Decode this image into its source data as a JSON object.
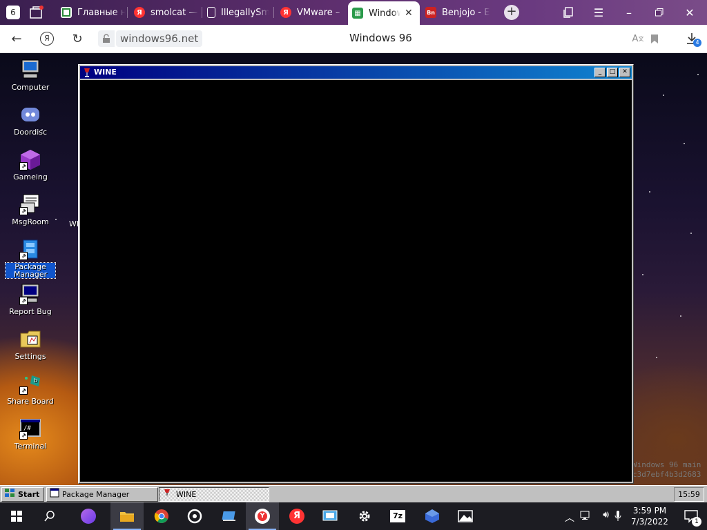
{
  "browser": {
    "tab_count": "6",
    "tabs": [
      {
        "label": "Главные н"
      },
      {
        "label": "smolcat —"
      },
      {
        "label": "IllegallySm"
      },
      {
        "label": "VMware –"
      },
      {
        "label": "Window"
      },
      {
        "label": "Benjojo - E"
      }
    ],
    "url": "windows96.net",
    "page_title": "Windows 96",
    "downloads_badge": "4"
  },
  "desktop": {
    "icons": [
      {
        "label": "Computer"
      },
      {
        "label": "Doordisc"
      },
      {
        "label": "Gameing"
      },
      {
        "label": "MsgRoom"
      },
      {
        "label": "Package\nManager"
      },
      {
        "label": "Report Bug"
      },
      {
        "label": "Settings"
      },
      {
        "label": "Share Board"
      },
      {
        "label": "Terminal"
      }
    ],
    "partial_label": "WI",
    "watermark_line1": "Windows 96 main",
    "watermark_line2": "c3d7ebf4b3d2683"
  },
  "wine_window": {
    "title": "WINE"
  },
  "w96_taskbar": {
    "start": "Start",
    "items": [
      {
        "label": "Package Manager"
      },
      {
        "label": "WINE"
      }
    ],
    "clock": "15:59"
  },
  "win_taskbar": {
    "time": "3:59 PM",
    "date": "7/3/2022",
    "notification_count": "1"
  }
}
